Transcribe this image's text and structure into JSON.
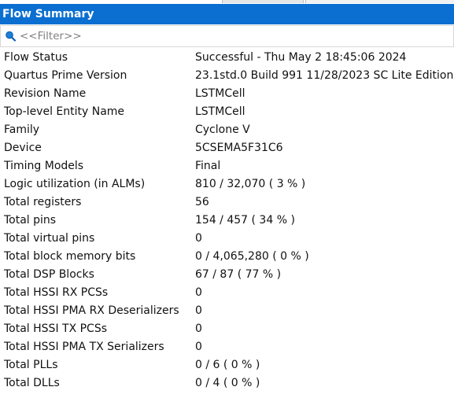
{
  "panel": {
    "title": "Flow Summary"
  },
  "filter": {
    "placeholder": "<<Filter>>"
  },
  "colors": {
    "title_bar": "#0a6fd1",
    "title_text": "#ffffff"
  },
  "rows": [
    {
      "label": "Flow Status",
      "value": "Successful - Thu May  2 18:45:06 2024"
    },
    {
      "label": "Quartus Prime Version",
      "value": "23.1std.0 Build 991 11/28/2023 SC Lite Edition"
    },
    {
      "label": "Revision Name",
      "value": "LSTMCell"
    },
    {
      "label": "Top-level Entity Name",
      "value": "LSTMCell"
    },
    {
      "label": "Family",
      "value": "Cyclone V"
    },
    {
      "label": "Device",
      "value": "5CSEMA5F31C6"
    },
    {
      "label": "Timing Models",
      "value": "Final"
    },
    {
      "label": "Logic utilization (in ALMs)",
      "value": "810 / 32,070 ( 3 % )"
    },
    {
      "label": "Total registers",
      "value": "56"
    },
    {
      "label": "Total pins",
      "value": "154 / 457 ( 34 % )"
    },
    {
      "label": "Total virtual pins",
      "value": "0"
    },
    {
      "label": "Total block memory bits",
      "value": "0 / 4,065,280 ( 0 % )"
    },
    {
      "label": "Total DSP Blocks",
      "value": "67 / 87 ( 77 % )"
    },
    {
      "label": "Total HSSI RX PCSs",
      "value": "0"
    },
    {
      "label": "Total HSSI PMA RX Deserializers",
      "value": "0"
    },
    {
      "label": "Total HSSI TX PCSs",
      "value": "0"
    },
    {
      "label": "Total HSSI PMA TX Serializers",
      "value": "0"
    },
    {
      "label": "Total PLLs",
      "value": "0 / 6 ( 0 % )"
    },
    {
      "label": "Total DLLs",
      "value": "0 / 4 ( 0 % )"
    }
  ]
}
